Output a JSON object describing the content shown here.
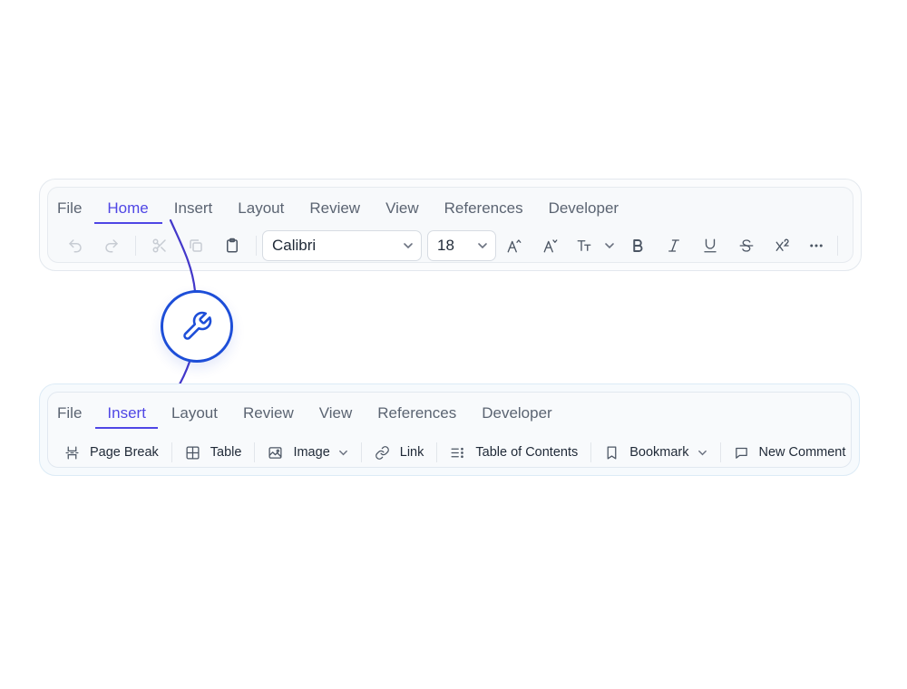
{
  "home_ribbon": {
    "tabs": [
      "File",
      "Home",
      "Insert",
      "Layout",
      "Review",
      "View",
      "References",
      "Developer"
    ],
    "active_tab": "Home",
    "font_name": "Calibri",
    "font_size": "18",
    "icons": [
      "undo-icon",
      "redo-icon",
      "cut-icon",
      "copy-icon",
      "paste-icon",
      "grow-font-icon",
      "shrink-font-icon",
      "change-case-icon",
      "bold-icon",
      "italic-icon",
      "underline-icon",
      "strikethrough-icon",
      "superscript-icon",
      "more-icon"
    ]
  },
  "insert_ribbon": {
    "tabs": [
      "File",
      "Insert",
      "Layout",
      "Review",
      "View",
      "References",
      "Developer"
    ],
    "active_tab": "Insert",
    "tools": [
      {
        "label": "Page Break",
        "icon": "page-break-icon"
      },
      {
        "label": "Table",
        "icon": "table-icon"
      },
      {
        "label": "Image",
        "icon": "image-icon"
      },
      {
        "label": "Link",
        "icon": "link-icon"
      },
      {
        "label": "Table of Contents",
        "icon": "toc-icon"
      },
      {
        "label": "Bookmark",
        "icon": "bookmark-icon"
      },
      {
        "label": "New Comment",
        "icon": "comment-icon"
      }
    ]
  },
  "colors": {
    "accent": "#4f46e5",
    "badge": "#1d4ed8",
    "connector": "#4338ca"
  }
}
